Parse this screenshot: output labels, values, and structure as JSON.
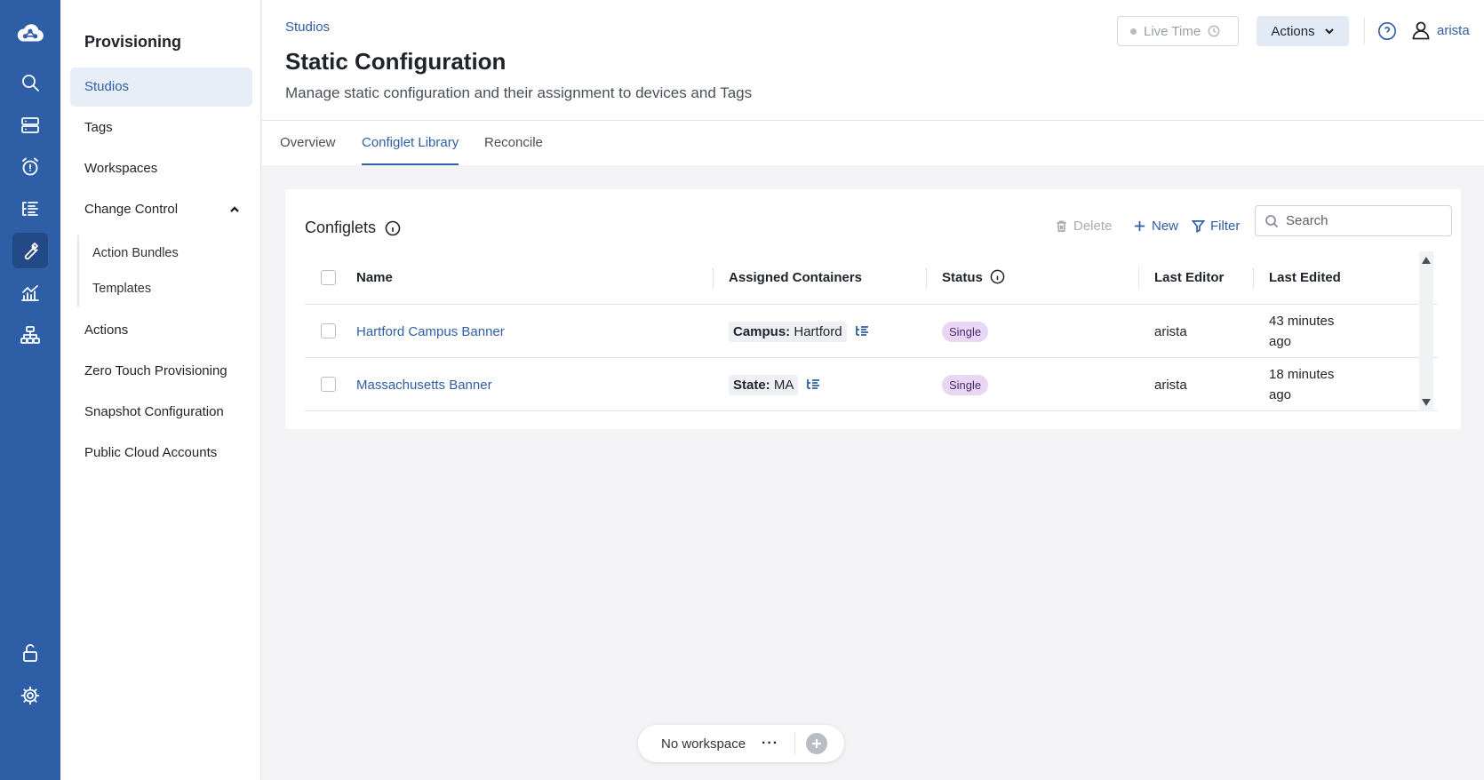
{
  "nav": {
    "title": "Provisioning",
    "items": [
      {
        "label": "Studios"
      },
      {
        "label": "Tags"
      },
      {
        "label": "Workspaces"
      },
      {
        "label": "Change Control"
      },
      {
        "label": "Actions"
      },
      {
        "label": "Zero Touch Provisioning"
      },
      {
        "label": "Snapshot Configuration"
      },
      {
        "label": "Public Cloud Accounts"
      }
    ],
    "sub_items": [
      {
        "label": "Action Bundles"
      },
      {
        "label": "Templates"
      }
    ]
  },
  "header": {
    "breadcrumb": "Studios",
    "title": "Static Configuration",
    "subtitle": "Manage static configuration and their assignment to devices and Tags",
    "live_time": "Live Time",
    "actions": "Actions",
    "user": "arista"
  },
  "tabs": [
    {
      "label": "Overview"
    },
    {
      "label": "Configlet Library"
    },
    {
      "label": "Reconcile"
    }
  ],
  "card": {
    "title": "Configlets",
    "delete": "Delete",
    "new": "New",
    "filter": "Filter",
    "search_placeholder": "Search"
  },
  "table": {
    "columns": [
      "Name",
      "Assigned Containers",
      "Status",
      "Last Editor",
      "Last Edited"
    ],
    "rows": [
      {
        "name": "Hartford Campus Banner",
        "container_key": "Campus:",
        "container_value": " Hartford",
        "status": "Single",
        "editor": "arista",
        "edited_1": "43 minutes",
        "edited_2": "ago"
      },
      {
        "name": "Massachusetts Banner",
        "container_key": "State:",
        "container_value": " MA",
        "status": "Single",
        "editor": "arista",
        "edited_1": "18 minutes",
        "edited_2": "ago"
      }
    ]
  },
  "workspace": {
    "label": "No workspace",
    "more": "···"
  }
}
